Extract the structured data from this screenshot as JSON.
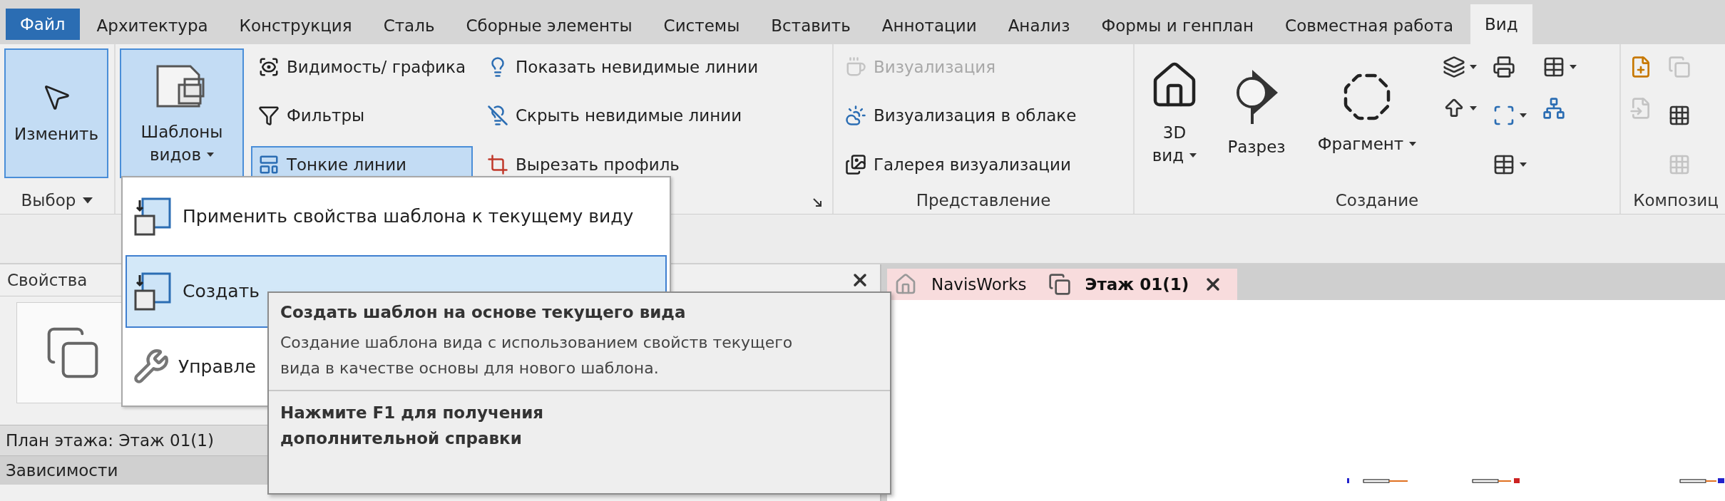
{
  "file_tabs": [
    {
      "label": "Файл",
      "kind": "file",
      "selected": false
    },
    {
      "label": "Архитектура",
      "kind": "tab",
      "selected": false
    },
    {
      "label": "Конструкция",
      "kind": "tab",
      "selected": false
    },
    {
      "label": "Сталь",
      "kind": "tab",
      "selected": false
    },
    {
      "label": "Сборные элементы",
      "kind": "tab",
      "selected": false
    },
    {
      "label": "Системы",
      "kind": "tab",
      "selected": false
    },
    {
      "label": "Вставить",
      "kind": "tab",
      "selected": false
    },
    {
      "label": "Аннотации",
      "kind": "tab",
      "selected": false
    },
    {
      "label": "Анализ",
      "kind": "tab",
      "selected": false
    },
    {
      "label": "Формы и генплан",
      "kind": "tab",
      "selected": false
    },
    {
      "label": "Совместная работа",
      "kind": "tab",
      "selected": false
    },
    {
      "label": "Вид",
      "kind": "tab",
      "selected": true
    }
  ],
  "ribbon_panels": [
    {
      "title": "Выбор",
      "title_dropdown": true,
      "launcher": false,
      "columns": [
        [
          {
            "kind": "large",
            "lines": [
              "Изменить"
            ],
            "active": true,
            "disabled": false,
            "dropdown": false
          }
        ]
      ]
    },
    {
      "launcher": true,
      "title_dropdown": false,
      "columns": [
        [
          {
            "kind": "large",
            "lines": [
              "Шаблоны",
              "видов"
            ],
            "active": true,
            "disabled": false,
            "dropdown": true
          }
        ],
        [
          {
            "kind": "small",
            "label": "Видимость/ графика",
            "active": false,
            "disabled": false,
            "dropdown": false
          },
          {
            "kind": "small",
            "label": "Фильтры",
            "active": false,
            "disabled": false,
            "dropdown": false
          },
          {
            "kind": "small",
            "label": "Тонкие линии",
            "active": true,
            "disabled": false,
            "dropdown": false
          }
        ],
        [
          {
            "kind": "small",
            "label": "Показать невидимые линии",
            "active": false,
            "disabled": false,
            "dropdown": false
          },
          {
            "kind": "small",
            "label": "Скрыть невидимые линии",
            "active": false,
            "disabled": false,
            "dropdown": false
          },
          {
            "kind": "small",
            "label": "Вырезать профиль",
            "active": false,
            "disabled": false,
            "dropdown": false
          }
        ]
      ]
    },
    {
      "title": "Представление",
      "title_dropdown": false,
      "launcher": false,
      "columns": [
        [
          {
            "kind": "small",
            "label": "Визуализация",
            "active": false,
            "disabled": true,
            "dropdown": false
          },
          {
            "kind": "small",
            "label": "Визуализация  в облаке",
            "active": false,
            "disabled": false,
            "dropdown": false
          },
          {
            "kind": "small",
            "label": "Галерея  визуализации",
            "active": false,
            "disabled": false,
            "dropdown": false
          }
        ]
      ]
    },
    {
      "title": "Создание",
      "title_dropdown": false,
      "launcher": false,
      "columns": [
        [
          {
            "kind": "large",
            "lines": [
              "3D",
              "вид"
            ],
            "active": false,
            "disabled": false,
            "dropdown": true
          }
        ],
        [
          {
            "kind": "large",
            "lines": [
              "Разрез"
            ],
            "active": false,
            "disabled": false,
            "dropdown": false
          }
        ],
        [
          {
            "kind": "large",
            "lines": [
              "Фрагмент"
            ],
            "active": false,
            "disabled": false,
            "dropdown": true
          }
        ],
        [
          {
            "kind": "icon",
            "active": false,
            "disabled": false,
            "dropdown": true
          },
          {
            "kind": "icon",
            "active": false,
            "disabled": false,
            "dropdown": true
          }
        ],
        [
          {
            "kind": "icon",
            "active": false,
            "disabled": false,
            "dropdown": false
          },
          {
            "kind": "icon",
            "active": false,
            "disabled": false,
            "dropdown": true
          },
          {
            "kind": "icon",
            "active": false,
            "disabled": false,
            "dropdown": true
          }
        ],
        [
          {
            "kind": "icon",
            "active": false,
            "disabled": false,
            "dropdown": true
          },
          {
            "kind": "icon",
            "active": false,
            "disabled": false,
            "dropdown": false
          }
        ]
      ]
    },
    {
      "title": "Композиц",
      "title_dropdown": false,
      "launcher": false,
      "columns": [
        [
          {
            "kind": "icon",
            "active": false,
            "disabled": false,
            "dropdown": false
          },
          {
            "kind": "icon",
            "active": false,
            "disabled": true,
            "dropdown": false
          }
        ],
        [
          {
            "kind": "icon",
            "active": false,
            "disabled": true,
            "dropdown": false
          },
          {
            "kind": "icon",
            "active": false,
            "disabled": false,
            "dropdown": false
          },
          {
            "kind": "icon",
            "active": false,
            "disabled": true,
            "dropdown": false
          }
        ]
      ]
    }
  ],
  "view_templates_menu": {
    "items": [
      {
        "label": "Применить свойства шаблона к текущему виду",
        "selected": false
      },
      {
        "label": "Создать",
        "selected": true
      },
      {
        "label": "Управле",
        "selected": false
      }
    ]
  },
  "tooltip": {
    "title": "Создать шаблон на основе текущего вида",
    "description": "Создание шаблона вида с использованием свойств текущего вида в качестве основы для нового шаблона.",
    "help": "Нажмите F1 для получения дополнительной справки"
  },
  "properties": {
    "title": "Свойства",
    "view_type": "План этажа: Этаж 01(1)",
    "section": "Зависимости"
  },
  "view_tabs": [
    {
      "label": "NavisWorks",
      "selected": false,
      "closable": false
    },
    {
      "label": "Этаж 01(1)",
      "selected": true,
      "closable": true
    }
  ]
}
